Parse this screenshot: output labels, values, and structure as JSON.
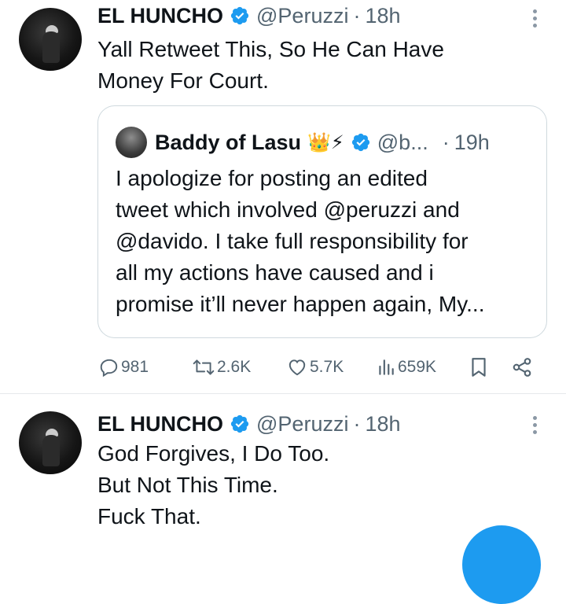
{
  "tweets": [
    {
      "author_name": "EL HUNCHO",
      "handle": "@Peruzzi",
      "separator": "·",
      "time": "18h",
      "text_lines": [
        "Yall Retweet This, So He Can Have",
        "Money For Court."
      ],
      "quote": {
        "author_name": "Baddy of Lasu",
        "emoji": "👑⚡",
        "handle": "@b...",
        "separator": "·",
        "time": "19h",
        "text_lines": [
          "I apologize for posting an edited",
          "tweet which involved @peruzzi and",
          "@davido. I take full responsibility for",
          "all my actions have caused and i",
          "promise it’ll never happen again, My..."
        ]
      },
      "actions": {
        "replies": "981",
        "retweets": "2.6K",
        "likes": "5.7K",
        "views": "659K"
      }
    },
    {
      "author_name": "EL HUNCHO",
      "handle": "@Peruzzi",
      "separator": "·",
      "time": "18h",
      "text_lines": [
        "God Forgives, I Do Too.",
        "But Not This Time.",
        "Fuck That."
      ]
    }
  ],
  "icons": {
    "verified": "verified-badge-icon",
    "more": "more-options-icon",
    "reply": "reply-icon",
    "retweet": "retweet-icon",
    "like": "like-icon",
    "views": "views-icon",
    "bookmark": "bookmark-icon",
    "share": "share-icon",
    "compose": "compose-icon"
  },
  "colors": {
    "accent": "#1d9bf0",
    "text": "#0f1419",
    "secondary_text": "#536471",
    "border": "#cfd9de"
  }
}
